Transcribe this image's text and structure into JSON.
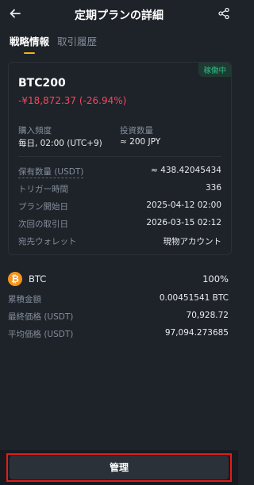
{
  "header": {
    "title": "定期プランの詳細",
    "back_icon": "arrow-left-icon",
    "share_icon": "share-icon"
  },
  "tabs": [
    {
      "label": "戦略情報",
      "active": true
    },
    {
      "label": "取引履歴",
      "active": false
    }
  ],
  "card": {
    "status": "稼働中",
    "strategy_name": "BTC200",
    "pnl": "-¥18,872.37 (-26.94%)",
    "purchase_frequency_label": "購入頻度",
    "purchase_frequency_value": "毎日, 02:00 (UTC+9)",
    "investment_amount_label": "投資数量",
    "investment_amount_value": "≈ 200 JPY",
    "details": [
      {
        "label": "保有数量 (USDT)",
        "value": "≈ 438.42045434"
      },
      {
        "label": "トリガー時間",
        "value": "336"
      },
      {
        "label": "プラン開始日",
        "value": "2025-04-12 02:00"
      },
      {
        "label": "次回の取引日",
        "value": "2026-03-15 02:12"
      },
      {
        "label": "宛先ウォレット",
        "value": "現物アカウント"
      }
    ]
  },
  "asset": {
    "icon": "bitcoin-icon",
    "name": "BTC",
    "percent": "100%",
    "rows": [
      {
        "label": "累積金額",
        "value": "0.00451541 BTC"
      },
      {
        "label": "最終価格 (USDT)",
        "value": "70,928.72"
      },
      {
        "label": "平均価格 (USDT)",
        "value": "97,094.273685"
      }
    ]
  },
  "footer": {
    "manage_label": "管理"
  },
  "colors": {
    "accent": "#f0b90b",
    "negative": "#f6465d",
    "positive": "#2ebd85",
    "highlight_box": "#e51b1b"
  }
}
